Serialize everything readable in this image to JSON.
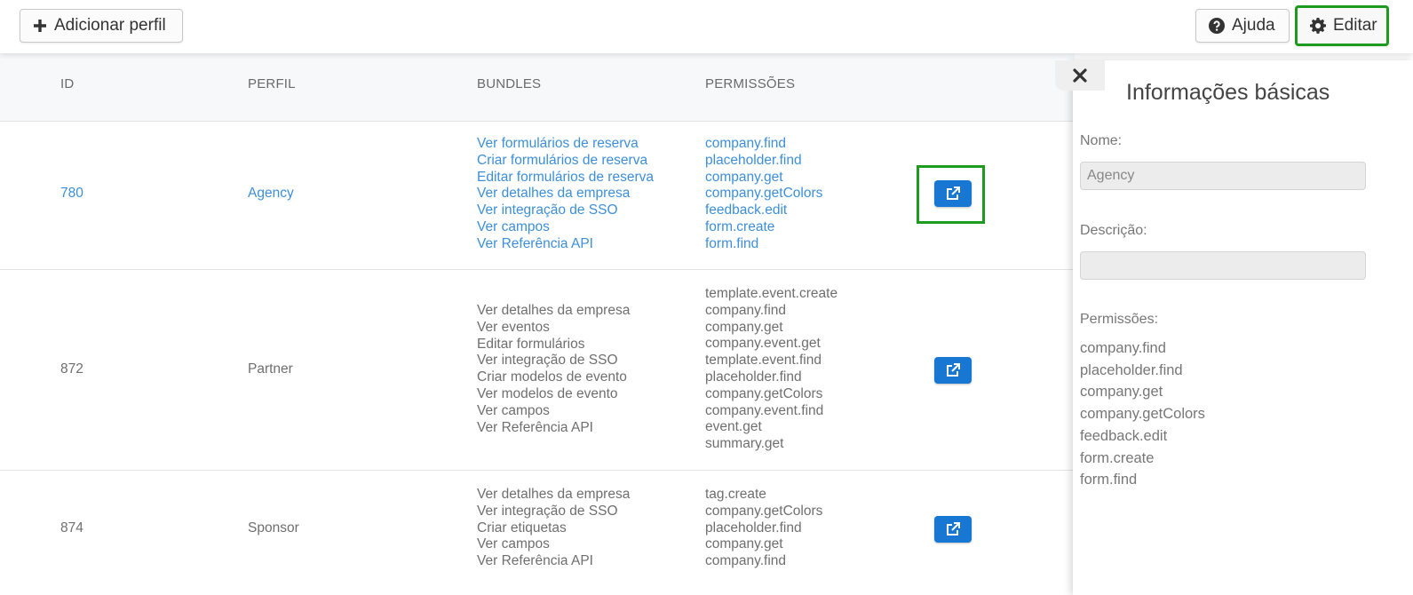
{
  "toolbar": {
    "add_label": "Adicionar perfil",
    "help_label": "Ajuda",
    "edit_label": "Editar"
  },
  "table": {
    "headers": [
      "ID",
      "PERFIL",
      "BUNDLES",
      "PERMISSÕES"
    ],
    "rows": [
      {
        "id": "780",
        "profile": "Agency",
        "bundles": [
          "Ver formulários de reserva",
          "Criar formulários de reserva",
          "Editar formulários de reserva",
          "Ver detalhes da empresa",
          "Ver integração de SSO",
          "Ver campos",
          "Ver Referência API"
        ],
        "permissions": [
          "company.find",
          "placeholder.find",
          "company.get",
          "company.getColors",
          "feedback.edit",
          "form.create",
          "form.find"
        ]
      },
      {
        "id": "872",
        "profile": "Partner",
        "bundles": [
          "Ver detalhes da empresa",
          "Ver eventos",
          "Editar formulários",
          "Ver integração de SSO",
          "Criar modelos de evento",
          "Ver modelos de evento",
          "Ver campos",
          "Ver Referência API"
        ],
        "permissions": [
          "template.event.create",
          "company.find",
          "company.get",
          "company.event.get",
          "template.event.find",
          "placeholder.find",
          "company.getColors",
          "company.event.find",
          "event.get",
          "summary.get"
        ]
      },
      {
        "id": "874",
        "profile": "Sponsor",
        "bundles": [
          "Ver detalhes da empresa",
          "Ver integração de SSO",
          "Criar etiquetas",
          "Ver campos",
          "Ver Referência API"
        ],
        "permissions": [
          "tag.create",
          "company.getColors",
          "placeholder.find",
          "company.get",
          "company.find"
        ]
      }
    ]
  },
  "panel": {
    "close_icon": "close-icon",
    "title": "Informações básicas",
    "name_label": "Nome:",
    "name_value": "Agency",
    "description_label": "Descrição:",
    "description_value": "",
    "permissions_label": "Permissões:",
    "permissions": [
      "company.find",
      "placeholder.find",
      "company.get",
      "company.getColors",
      "feedback.edit",
      "form.create",
      "form.find"
    ]
  },
  "colors": {
    "link": "#3d8fd8",
    "action_button": "#1777d3",
    "highlight": "#1e9a1e"
  }
}
